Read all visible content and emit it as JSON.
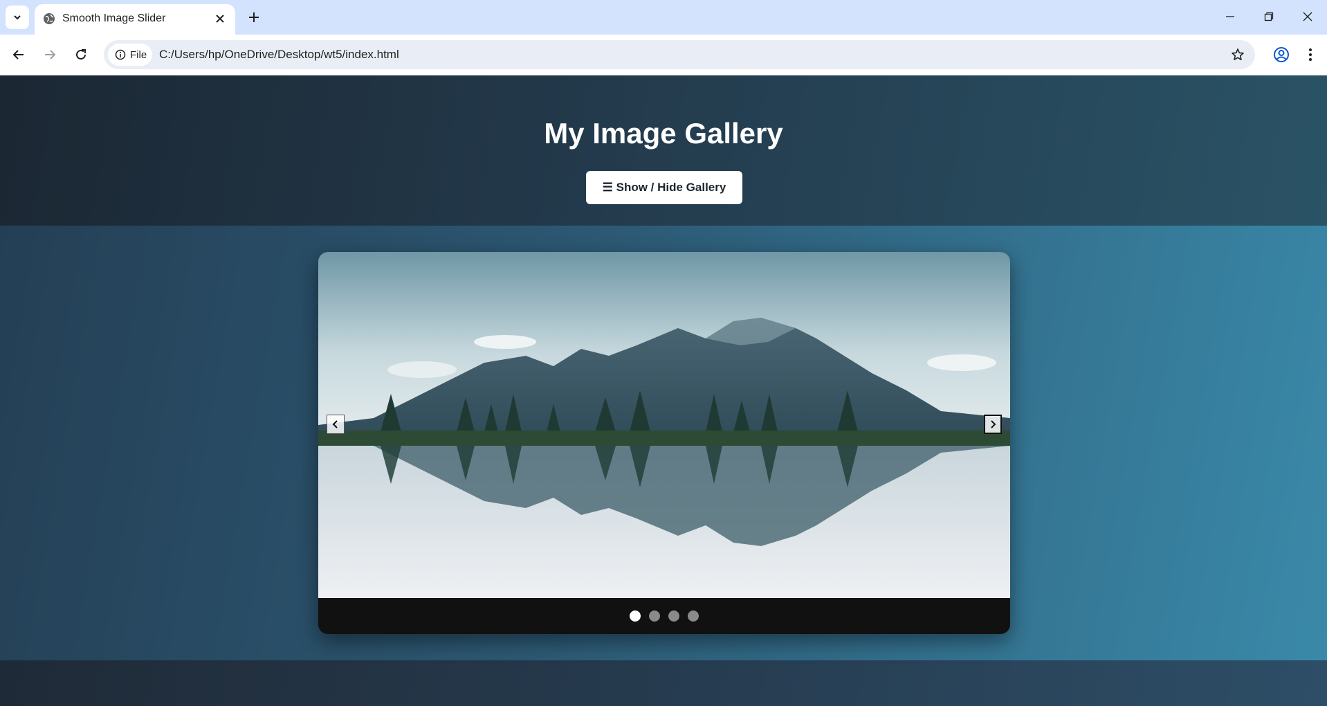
{
  "browser": {
    "tab_title": "Smooth Image Slider",
    "omnibox": {
      "chip_label": "File",
      "url": "C:/Users/hp/OneDrive/Desktop/wt5/index.html"
    }
  },
  "page": {
    "title": "My Image Gallery",
    "toggle_button_label": "☰ Show / Hide Gallery",
    "slider": {
      "image_subject": "mountain lake landscape with tree reflections",
      "slide_count": 4,
      "active_index": 0,
      "prev_icon": "chevron-left-icon",
      "next_icon": "chevron-right-icon"
    }
  },
  "colors": {
    "tabstrip": "#d3e3fd",
    "header_bg": "#1b2733",
    "gallery_bg": "#2d5a75",
    "button_bg": "#ffffff",
    "dots_bar": "#111111",
    "active_dot": "#ffffff",
    "inactive_dot": "#8a8a8a"
  }
}
